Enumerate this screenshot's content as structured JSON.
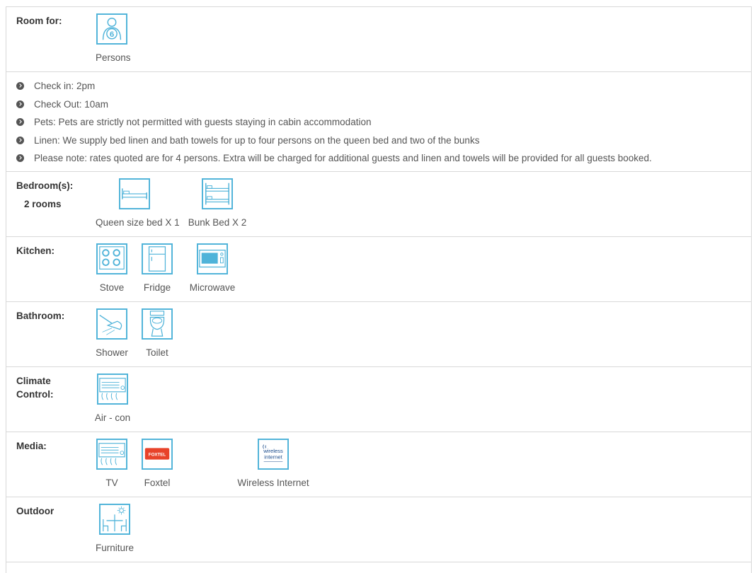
{
  "room_for": {
    "label": "Room for:",
    "count": "6",
    "caption": "Persons"
  },
  "notes": [
    "Check in: 2pm",
    "Check Out: 10am",
    "Pets: Pets are strictly not permitted with guests staying in cabin accommodation",
    "Linen: We supply bed linen and bath towels for up to four persons on the queen bed and two of the bunks",
    "Please note: rates quoted are for 4 persons. Extra will be charged for additional guests and linen and towels will be provided for all guests booked."
  ],
  "bedrooms": {
    "label": "Bedroom(s):",
    "rooms": "2 rooms",
    "items": [
      "Queen size bed X 1",
      "Bunk Bed X 2"
    ]
  },
  "kitchen": {
    "label": "Kitchen:",
    "items": [
      "Stove",
      "Fridge",
      "Microwave"
    ]
  },
  "bathroom": {
    "label": "Bathroom:",
    "items": [
      "Shower",
      "Toilet"
    ]
  },
  "climate": {
    "label_line1": "Climate",
    "label_line2": "Control:",
    "items": [
      "Air - con"
    ]
  },
  "media": {
    "label": "Media:",
    "items": [
      "TV",
      "Foxtel",
      "Wireless Internet"
    ],
    "foxtel_logo": "FOXTEL",
    "wireless_logo_line1": "wireless",
    "wireless_logo_line2": "internet"
  },
  "outdoor": {
    "label": "Outdoor",
    "items": [
      "Furniture"
    ]
  },
  "colors": {
    "accent": "#4fb3d9",
    "border": "#d8d8d8",
    "foxtel": "#e8432a"
  }
}
